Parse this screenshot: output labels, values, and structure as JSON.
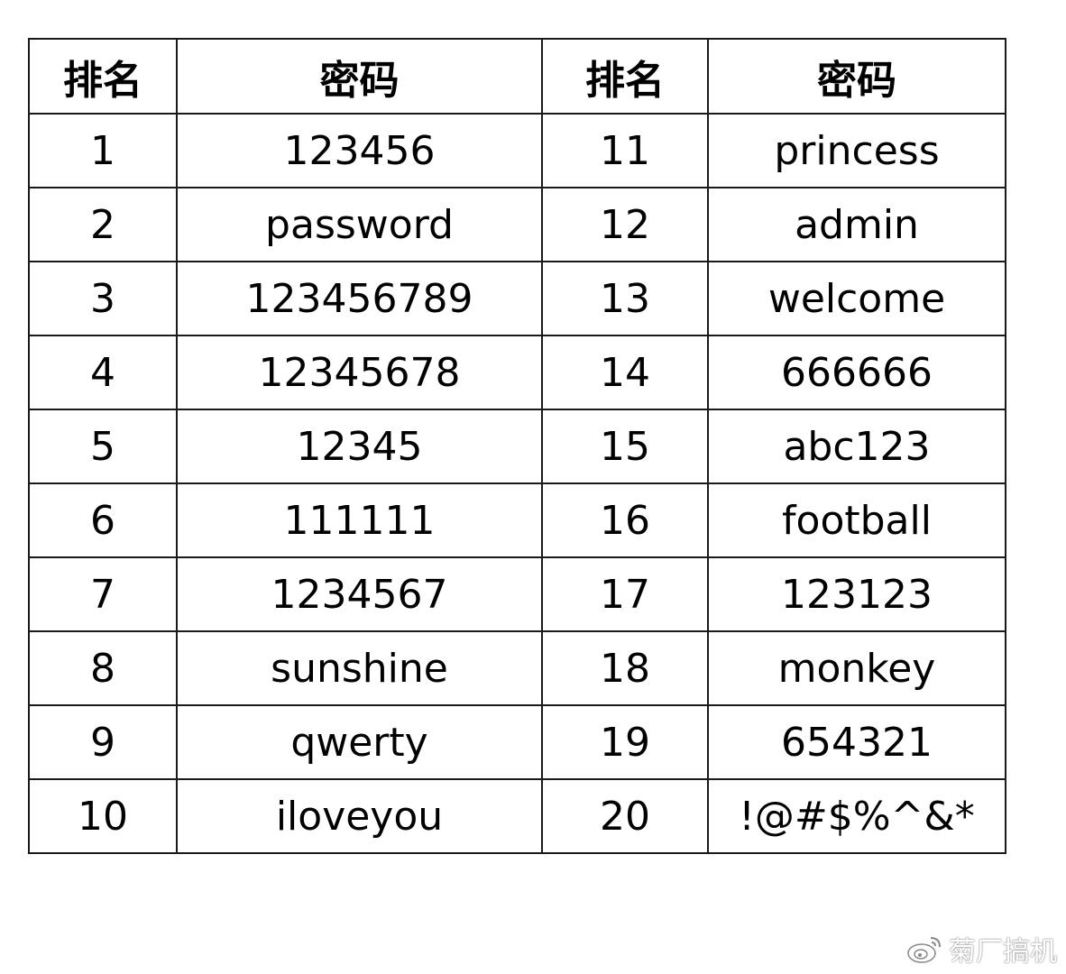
{
  "table": {
    "headers": [
      "排名",
      "密码",
      "排名",
      "密码"
    ],
    "rows": [
      {
        "rank_left": "1",
        "password_left": "123456",
        "rank_right": "11",
        "password_right": "princess"
      },
      {
        "rank_left": "2",
        "password_left": "password",
        "rank_right": "12",
        "password_right": "admin"
      },
      {
        "rank_left": "3",
        "password_left": "123456789",
        "rank_right": "13",
        "password_right": "welcome"
      },
      {
        "rank_left": "4",
        "password_left": "12345678",
        "rank_right": "14",
        "password_right": "666666"
      },
      {
        "rank_left": "5",
        "password_left": "12345",
        "rank_right": "15",
        "password_right": "abc123"
      },
      {
        "rank_left": "6",
        "password_left": "111111",
        "rank_right": "16",
        "password_right": "football"
      },
      {
        "rank_left": "7",
        "password_left": "1234567",
        "rank_right": "17",
        "password_right": "123123"
      },
      {
        "rank_left": "8",
        "password_left": "sunshine",
        "rank_right": "18",
        "password_right": "monkey"
      },
      {
        "rank_left": "9",
        "password_left": "qwerty",
        "rank_right": "19",
        "password_right": "654321"
      },
      {
        "rank_left": "10",
        "password_left": "iloveyou",
        "rank_right": "20",
        "password_right": "!@#$%^&*"
      }
    ]
  },
  "watermark": {
    "icon": "weibo-icon",
    "text": "菊厂搞机"
  }
}
